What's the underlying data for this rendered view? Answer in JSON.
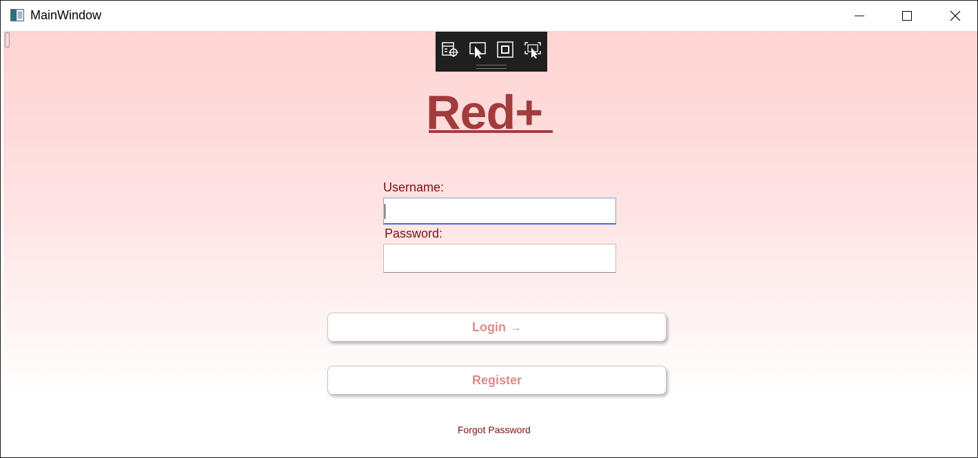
{
  "window": {
    "title": "MainWindow",
    "icons": {
      "app": "app-window-icon",
      "minimize": "minimize-icon",
      "maximize": "maximize-icon",
      "close": "close-icon"
    }
  },
  "dev_toolbar": {
    "tools": [
      "select-element-icon",
      "element-picker-icon",
      "display-layout-adorners-icon",
      "track-focused-element-icon"
    ]
  },
  "app": {
    "logo_text": "Red+",
    "username_label": "Username:",
    "username_value": "",
    "password_label": "Password:",
    "password_value": "",
    "login_button": "Login →",
    "register_button": "Register",
    "forgot_password": "Forgot Password"
  },
  "colors": {
    "accent": "#a23c3c",
    "label": "#7a1010",
    "button_text": "#e08a8a",
    "bg_top": "#ffd3d3",
    "bg_bottom": "#ffffff"
  }
}
